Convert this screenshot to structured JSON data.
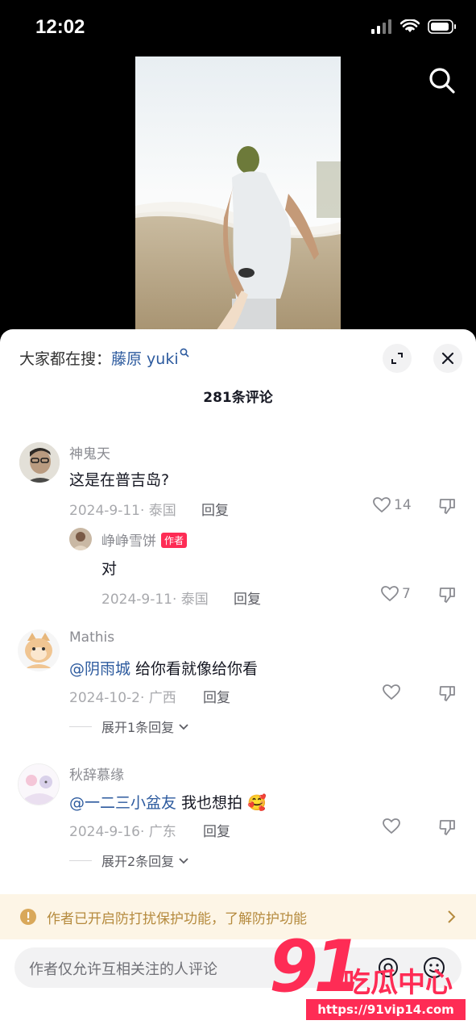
{
  "status_bar": {
    "time": "12:02"
  },
  "sheet": {
    "trending_prefix": "大家都在搜：",
    "trending_keyword": "藤原 yuki",
    "comment_count": "281条评论"
  },
  "comments": [
    {
      "username": "神鬼天",
      "text": "这是在普吉岛?",
      "date_location": "2024-9-11· 泰国",
      "reply_label": "回复",
      "likes": "14"
    },
    {
      "username": "峥峥雪饼",
      "author_tag": "作者",
      "text": "对",
      "date_location": "2024-9-11· 泰国",
      "reply_label": "回复",
      "likes": "7"
    },
    {
      "username": "Mathis",
      "mention": "@阴雨城",
      "text": " 给你看就像给你看",
      "date_location": "2024-10-2· 广西",
      "reply_label": "回复",
      "expand_label": "展开1条回复"
    },
    {
      "username": "秋辞慕缘",
      "mention": "@一二三小盆友",
      "text": " 我也想拍",
      "emoji": "🥰",
      "date_location": "2024-9-16· 广东",
      "reply_label": "回复",
      "expand_label": "展开2条回复"
    }
  ],
  "notice": {
    "text": "作者已开启防打扰保护功能，了解防护功能"
  },
  "input": {
    "placeholder": "作者仅允许互相关注的人评论"
  },
  "watermark": {
    "number": "91",
    "brand": "吃瓜中心",
    "url": "https://91vip14.com"
  },
  "colors": {
    "accent": "#fe2c55",
    "link": "#2c5a9e",
    "notice_bg": "#fdf5e6",
    "notice_text": "#b58a3d"
  },
  "icons": [
    "search-icon",
    "expand-icon",
    "close-icon",
    "heart-icon",
    "dislike-icon",
    "warning-icon",
    "chevron-right-icon",
    "chevron-down-icon",
    "at-icon",
    "emoji-icon"
  ]
}
